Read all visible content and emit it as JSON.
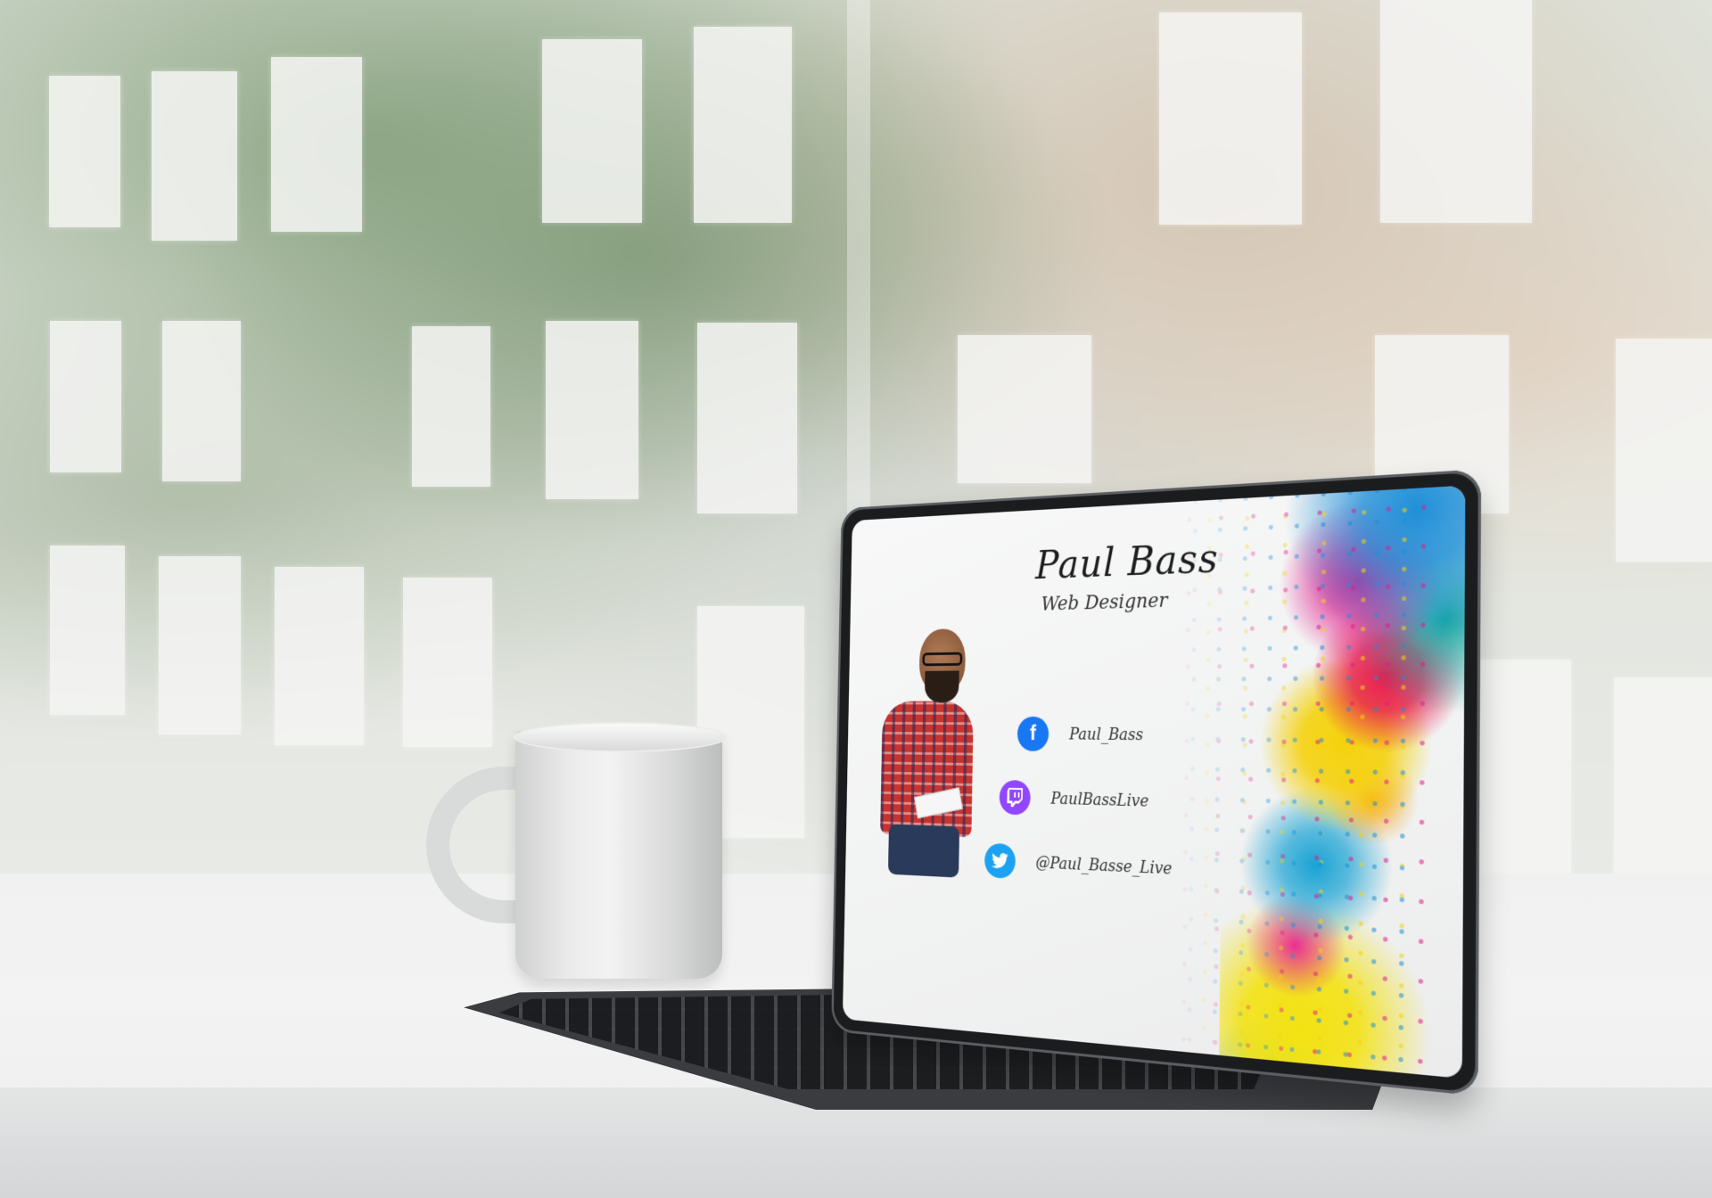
{
  "card": {
    "name": "Paul Bass",
    "role": "Web Designer"
  },
  "social": [
    {
      "network": "facebook",
      "icon": "facebook-icon",
      "handle": "Paul_Bass",
      "color": "#1877F2"
    },
    {
      "network": "twitch",
      "icon": "twitch-icon",
      "handle": "PaulBassLive",
      "color": "#9146FF"
    },
    {
      "network": "twitter",
      "icon": "twitter-icon",
      "handle": "@Paul_Basse_Live",
      "color": "#1DA1F2"
    }
  ],
  "colors": {
    "splash_magenta": "#e21c8c",
    "splash_blue": "#1f8fd8",
    "splash_yellow": "#f5d20e"
  }
}
